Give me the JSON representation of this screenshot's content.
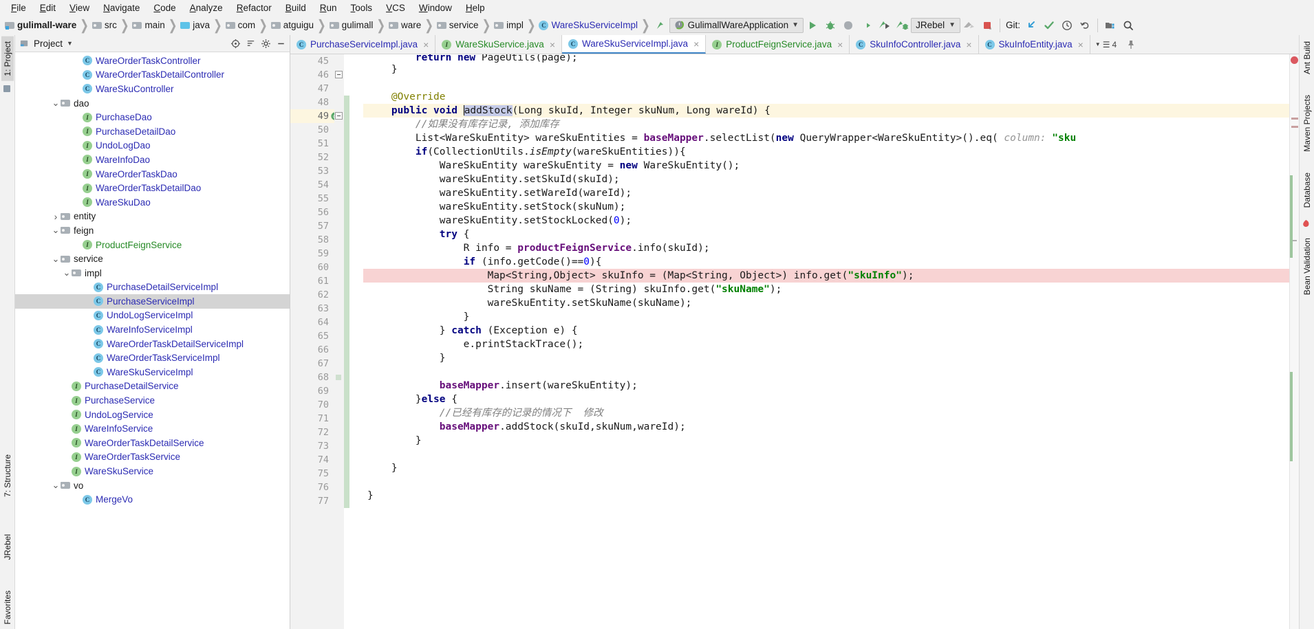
{
  "menubar": {
    "items": [
      "File",
      "Edit",
      "View",
      "Navigate",
      "Code",
      "Analyze",
      "Refactor",
      "Build",
      "Run",
      "Tools",
      "VCS",
      "Window",
      "Help"
    ]
  },
  "navbar": {
    "breadcrumbs": [
      {
        "label": "gulimall-ware",
        "icon": "module-folder-icon",
        "style": "bold"
      },
      {
        "label": "src",
        "icon": "folder-icon",
        "style": "normal"
      },
      {
        "label": "main",
        "icon": "folder-icon",
        "style": "normal"
      },
      {
        "label": "java",
        "icon": "source-folder-icon",
        "style": "normal"
      },
      {
        "label": "com",
        "icon": "package-folder-icon",
        "style": "normal"
      },
      {
        "label": "atguigu",
        "icon": "package-folder-icon",
        "style": "normal"
      },
      {
        "label": "gulimall",
        "icon": "package-folder-icon",
        "style": "normal"
      },
      {
        "label": "ware",
        "icon": "package-folder-icon",
        "style": "normal"
      },
      {
        "label": "service",
        "icon": "package-folder-icon",
        "style": "normal"
      },
      {
        "label": "impl",
        "icon": "package-folder-icon",
        "style": "normal"
      },
      {
        "label": "WareSkuServiceImpl",
        "icon": "class-icon",
        "style": "link"
      }
    ],
    "run_config": "GulimallWareApplication",
    "jrebel_label": "JRebel",
    "git_label": "Git:",
    "buttons": [
      "run-button",
      "debug-button",
      "run-coverage-button",
      "run-with-profiler-button",
      "jrebel-run-button",
      "jrebel-debug-button"
    ]
  },
  "project_panel": {
    "title": "Project",
    "tree": [
      {
        "indent": 5,
        "arrow": "",
        "icon": "class-icon",
        "label": "WareOrderTaskController",
        "color": "blue"
      },
      {
        "indent": 5,
        "arrow": "",
        "icon": "class-icon",
        "label": "WareOrderTaskDetailController",
        "color": "blue"
      },
      {
        "indent": 5,
        "arrow": "",
        "icon": "class-icon",
        "label": "WareSkuController",
        "color": "blue"
      },
      {
        "indent": 3,
        "arrow": "down",
        "icon": "package-folder-icon",
        "label": "dao",
        "color": "black"
      },
      {
        "indent": 5,
        "arrow": "",
        "icon": "interface-icon",
        "label": "PurchaseDao",
        "color": "blue"
      },
      {
        "indent": 5,
        "arrow": "",
        "icon": "interface-icon",
        "label": "PurchaseDetailDao",
        "color": "blue"
      },
      {
        "indent": 5,
        "arrow": "",
        "icon": "interface-icon",
        "label": "UndoLogDao",
        "color": "blue"
      },
      {
        "indent": 5,
        "arrow": "",
        "icon": "interface-icon",
        "label": "WareInfoDao",
        "color": "blue"
      },
      {
        "indent": 5,
        "arrow": "",
        "icon": "interface-icon",
        "label": "WareOrderTaskDao",
        "color": "blue"
      },
      {
        "indent": 5,
        "arrow": "",
        "icon": "interface-icon",
        "label": "WareOrderTaskDetailDao",
        "color": "blue"
      },
      {
        "indent": 5,
        "arrow": "",
        "icon": "interface-icon",
        "label": "WareSkuDao",
        "color": "blue"
      },
      {
        "indent": 3,
        "arrow": "right",
        "icon": "package-folder-icon",
        "label": "entity",
        "color": "black"
      },
      {
        "indent": 3,
        "arrow": "down",
        "icon": "package-folder-icon",
        "label": "feign",
        "color": "black"
      },
      {
        "indent": 5,
        "arrow": "",
        "icon": "interface-icon",
        "label": "ProductFeignService",
        "color": "green"
      },
      {
        "indent": 3,
        "arrow": "down",
        "icon": "package-folder-icon",
        "label": "service",
        "color": "black"
      },
      {
        "indent": 4,
        "arrow": "down",
        "icon": "package-folder-icon",
        "label": "impl",
        "color": "black"
      },
      {
        "indent": 6,
        "arrow": "",
        "icon": "class-icon",
        "label": "PurchaseDetailServiceImpl",
        "color": "blue"
      },
      {
        "indent": 6,
        "arrow": "",
        "icon": "class-icon",
        "label": "PurchaseServiceImpl",
        "color": "blue",
        "selected": true
      },
      {
        "indent": 6,
        "arrow": "",
        "icon": "class-icon",
        "label": "UndoLogServiceImpl",
        "color": "blue"
      },
      {
        "indent": 6,
        "arrow": "",
        "icon": "class-icon",
        "label": "WareInfoServiceImpl",
        "color": "blue"
      },
      {
        "indent": 6,
        "arrow": "",
        "icon": "class-icon",
        "label": "WareOrderTaskDetailServiceImpl",
        "color": "blue"
      },
      {
        "indent": 6,
        "arrow": "",
        "icon": "class-icon",
        "label": "WareOrderTaskServiceImpl",
        "color": "blue"
      },
      {
        "indent": 6,
        "arrow": "",
        "icon": "class-icon",
        "label": "WareSkuServiceImpl",
        "color": "blue"
      },
      {
        "indent": 4,
        "arrow": "",
        "icon": "interface-icon",
        "label": "PurchaseDetailService",
        "color": "blue"
      },
      {
        "indent": 4,
        "arrow": "",
        "icon": "interface-icon",
        "label": "PurchaseService",
        "color": "blue"
      },
      {
        "indent": 4,
        "arrow": "",
        "icon": "interface-icon",
        "label": "UndoLogService",
        "color": "blue"
      },
      {
        "indent": 4,
        "arrow": "",
        "icon": "interface-icon",
        "label": "WareInfoService",
        "color": "blue"
      },
      {
        "indent": 4,
        "arrow": "",
        "icon": "interface-icon",
        "label": "WareOrderTaskDetailService",
        "color": "blue"
      },
      {
        "indent": 4,
        "arrow": "",
        "icon": "interface-icon",
        "label": "WareOrderTaskService",
        "color": "blue"
      },
      {
        "indent": 4,
        "arrow": "",
        "icon": "interface-icon",
        "label": "WareSkuService",
        "color": "blue"
      },
      {
        "indent": 3,
        "arrow": "down",
        "icon": "package-folder-icon",
        "label": "vo",
        "color": "black"
      },
      {
        "indent": 5,
        "arrow": "",
        "icon": "class-icon",
        "label": "MergeVo",
        "color": "blue"
      }
    ]
  },
  "editor_tabs": {
    "tabs": [
      {
        "label": "PurchaseServiceImpl.java",
        "icon": "class-icon",
        "active": false
      },
      {
        "label": "WareSkuService.java",
        "icon": "interface-icon",
        "active": false
      },
      {
        "label": "WareSkuServiceImpl.java",
        "icon": "class-icon",
        "active": true
      },
      {
        "label": "ProductFeignService.java",
        "icon": "interface-icon",
        "active": false
      },
      {
        "label": "SkuInfoController.java",
        "icon": "class-icon",
        "active": false
      },
      {
        "label": "SkuInfoEntity.java",
        "icon": "class-icon",
        "active": false
      }
    ],
    "overflow_count": "4"
  },
  "left_rail": {
    "tabs": [
      "1: Project",
      "7: Structure",
      "JRebel",
      "Favorites"
    ]
  },
  "right_rail": {
    "tabs": [
      "Ant Build",
      "Maven Projects",
      "Database",
      "Bean Validation"
    ]
  },
  "editor": {
    "first_line": 45,
    "current_line": 49,
    "breakpoint_line": 61,
    "lines": [
      {
        "n": 45,
        "html": "        <span class=\"kw\">return</span> <span class=\"kw\">new</span> PageUtils(page);",
        "state": "clipped"
      },
      {
        "n": 46,
        "html": "    }",
        "state": "normal"
      },
      {
        "n": 47,
        "html": "",
        "state": "normal"
      },
      {
        "n": 48,
        "html": "    <span class=\"anno\">@Override</span>",
        "state": "normal"
      },
      {
        "n": 49,
        "html": "    <span class=\"kw\">public void </span><span class=\"caret-here\"></span><span class=\"sel-tok\">addStock</span>(Long skuId, Integer skuNum, Long wareId) {",
        "state": "current"
      },
      {
        "n": 50,
        "html": "        <span class=\"cmt\">//如果没有库存记录, 添加库存</span>",
        "state": "normal"
      },
      {
        "n": 51,
        "html": "        List&lt;WareSkuEntity&gt; wareSkuEntities = <span class=\"fld\">baseMapper</span>.selectList(<span class=\"kw\">new</span> QueryWrapper&lt;WareSkuEntity&gt;().eq( <span class=\"param-hint\">column:</span> <span class=\"str\">\"sku</span>",
        "state": "normal"
      },
      {
        "n": 52,
        "html": "        <span class=\"kw\">if</span>(CollectionUtils.<span class=\"stat\">isEmpty</span>(wareSkuEntities)){",
        "state": "normal"
      },
      {
        "n": 53,
        "html": "            WareSkuEntity wareSkuEntity = <span class=\"kw\">new</span> WareSkuEntity();",
        "state": "normal"
      },
      {
        "n": 54,
        "html": "            wareSkuEntity.setSkuId(skuId);",
        "state": "normal"
      },
      {
        "n": 55,
        "html": "            wareSkuEntity.setWareId(wareId);",
        "state": "normal"
      },
      {
        "n": 56,
        "html": "            wareSkuEntity.setStock(skuNum);",
        "state": "normal"
      },
      {
        "n": 57,
        "html": "            wareSkuEntity.setStockLocked(<span class=\"num\">0</span>);",
        "state": "normal"
      },
      {
        "n": 58,
        "html": "            <span class=\"kw\">try</span> {",
        "state": "normal"
      },
      {
        "n": 59,
        "html": "                R info = <span class=\"fld\">productFeignService</span>.info(skuId);",
        "state": "normal"
      },
      {
        "n": 60,
        "html": "                <span class=\"kw\">if</span> (info.getCode()==<span class=\"num\">0</span>){",
        "state": "normal"
      },
      {
        "n": 61,
        "html": "                    Map&lt;String,Object&gt; skuInfo = (Map&lt;String, Object&gt;) info.get(<span class=\"str\">\"skuInfo\"</span>);",
        "state": "breakpoint"
      },
      {
        "n": 62,
        "html": "                    String skuName = (String) skuInfo.get(<span class=\"str\">\"skuName\"</span>);",
        "state": "normal"
      },
      {
        "n": 63,
        "html": "                    wareSkuEntity.setSkuName(skuName);",
        "state": "normal"
      },
      {
        "n": 64,
        "html": "                }",
        "state": "normal"
      },
      {
        "n": 65,
        "html": "            } <span class=\"kw\">catch</span> (Exception e) {",
        "state": "normal"
      },
      {
        "n": 66,
        "html": "                e.printStackTrace();",
        "state": "normal"
      },
      {
        "n": 67,
        "html": "            }",
        "state": "normal"
      },
      {
        "n": 68,
        "html": "",
        "state": "normal"
      },
      {
        "n": 69,
        "html": "            <span class=\"fld\">baseMapper</span>.insert(wareSkuEntity);",
        "state": "normal"
      },
      {
        "n": 70,
        "html": "        }<span class=\"kw\">else</span> {",
        "state": "normal"
      },
      {
        "n": 71,
        "html": "            <span class=\"cmt\">//已经有库存的记录的情况下  修改</span>",
        "state": "normal"
      },
      {
        "n": 72,
        "html": "            <span class=\"fld\">baseMapper</span>.addStock(skuId,skuNum,wareId);",
        "state": "normal"
      },
      {
        "n": 73,
        "html": "        }",
        "state": "normal"
      },
      {
        "n": 74,
        "html": "",
        "state": "normal"
      },
      {
        "n": 75,
        "html": "    }",
        "state": "normal"
      },
      {
        "n": 76,
        "html": "",
        "state": "normal"
      },
      {
        "n": 77,
        "html": "}",
        "state": "normal"
      }
    ]
  },
  "colors": {
    "accent_blue": "#2b2bb3",
    "class_icon": "#7cc8e8",
    "interface_icon": "#96cf8f",
    "selection": "#d4d4d4",
    "current_line": "#fdf6e0",
    "breakpoint_line": "#f8d3d3",
    "breakpoint_dot": "#db5860",
    "error_stripe": "#db5860",
    "folder": "#a9b0b6"
  }
}
